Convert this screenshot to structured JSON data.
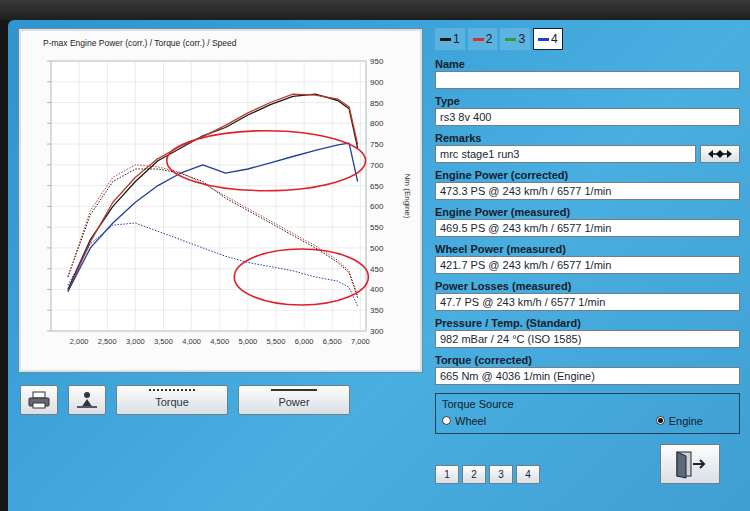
{
  "chart": {
    "title": "P-max Engine Power (corr.) / Torque (corr.) / Speed",
    "axis_title": "Nm (Engine)",
    "y_ticks": [
      {
        "label": "950",
        "value": 950
      },
      {
        "label": "900",
        "value": 900
      },
      {
        "label": "850",
        "value": 850
      },
      {
        "label": "800",
        "value": 800
      },
      {
        "label": "750",
        "value": 750
      },
      {
        "label": "700",
        "value": 700
      },
      {
        "label": "650",
        "value": 650
      },
      {
        "label": "600",
        "value": 600
      },
      {
        "label": "550",
        "value": 550
      },
      {
        "label": "500",
        "value": 500
      },
      {
        "label": "450",
        "value": 450
      },
      {
        "label": "400",
        "value": 400
      },
      {
        "label": "350",
        "value": 350
      },
      {
        "label": "300",
        "value": 300
      }
    ],
    "x_ticks": [
      {
        "label": "2,000",
        "value": 2000
      },
      {
        "label": "2,500",
        "value": 2500
      },
      {
        "label": "3,000",
        "value": 3000
      },
      {
        "label": "3,500",
        "value": 3500
      },
      {
        "label": "4,000",
        "value": 4000
      },
      {
        "label": "4,500",
        "value": 4500
      },
      {
        "label": "5,000",
        "value": 5000
      },
      {
        "label": "5,500",
        "value": 5500
      },
      {
        "label": "6,000",
        "value": 6000
      },
      {
        "label": "6,500",
        "value": 6500
      },
      {
        "label": "7,000",
        "value": 7000
      }
    ],
    "x_values": [
      1800,
      2200,
      2600,
      3000,
      3400,
      3800,
      4200,
      4600,
      5000,
      5400,
      5800,
      6200,
      6600,
      6800,
      6950
    ],
    "series": [
      {
        "kind": "solid",
        "color": "#1a1a1a",
        "values": [
          400,
          520,
          600,
          660,
          710,
          740,
          770,
          790,
          820,
          845,
          865,
          870,
          855,
          835,
          740
        ]
      },
      {
        "kind": "solid",
        "color": "#c0392b",
        "values": [
          395,
          515,
          610,
          670,
          715,
          745,
          768,
          795,
          825,
          850,
          870,
          868,
          858,
          840,
          750
        ]
      },
      {
        "kind": "solid",
        "color": "#1f3fa0",
        "values": [
          395,
          500,
          560,
          610,
          650,
          680,
          700,
          680,
          690,
          705,
          720,
          735,
          748,
          752,
          660
        ]
      },
      {
        "kind": "dotted",
        "color": "#1a1a1a",
        "values": [
          430,
          580,
          660,
          690,
          690,
          680,
          660,
          620,
          590,
          560,
          530,
          500,
          465,
          440,
          380
        ]
      },
      {
        "kind": "dotted",
        "color": "#c0392b",
        "values": [
          430,
          590,
          670,
          700,
          695,
          682,
          655,
          625,
          595,
          565,
          535,
          505,
          470,
          445,
          385
        ]
      },
      {
        "kind": "dotted",
        "color": "#1f3fa0",
        "values": [
          410,
          510,
          555,
          560,
          540,
          520,
          500,
          480,
          465,
          455,
          445,
          430,
          420,
          405,
          360
        ]
      }
    ]
  },
  "toolbar": [
    {
      "label": "Torque",
      "kind": "dotted"
    },
    {
      "label": "Power",
      "kind": "solid"
    }
  ],
  "tabs": [
    {
      "label": "1",
      "color": "#111111",
      "selected": false
    },
    {
      "label": "2",
      "color": "#d93030",
      "selected": false
    },
    {
      "label": "3",
      "color": "#2e9e3f",
      "selected": false
    },
    {
      "label": "4",
      "color": "#1f3fd0",
      "selected": true
    }
  ],
  "fields": [
    {
      "label": "Name",
      "value": "",
      "kind": "plain"
    },
    {
      "label": "Type",
      "value": "rs3 8v 400",
      "kind": "plain"
    },
    {
      "label": "Remarks",
      "value": "mrc stage1 run3",
      "kind": "button"
    },
    {
      "label": "Engine Power (corrected)",
      "value": "473.3 PS @ 243 km/h / 6577 1/min",
      "kind": "plain"
    },
    {
      "label": "Engine Power (measured)",
      "value": "469.5 PS @ 243 km/h / 6577 1/min",
      "kind": "plain"
    },
    {
      "label": "Wheel Power (measured)",
      "value": "421.7 PS @ 243 km/h / 6577 1/min",
      "kind": "plain"
    },
    {
      "label": "Power Losses (measured)",
      "value": "47.7 PS @ 243 km/h / 6577 1/min",
      "kind": "plain"
    },
    {
      "label": "Pressure / Temp. (Standard)",
      "value": "982 mBar / 24 °C (ISO 1585)",
      "kind": "plain"
    },
    {
      "label": "Torque (corrected)",
      "value": "665 Nm @ 4036 1/min (Engine)",
      "kind": "plain"
    }
  ],
  "torque_source": {
    "title": "Torque Source",
    "options": [
      {
        "label": "Wheel",
        "selected": false
      },
      {
        "label": "Engine",
        "selected": true
      }
    ]
  },
  "number_buttons": [
    "1",
    "2",
    "3",
    "4"
  ]
}
